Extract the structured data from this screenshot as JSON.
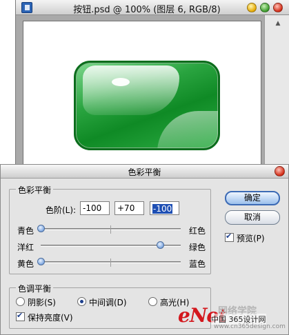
{
  "document": {
    "title": "按钮.psd @ 100% (图层 6, RGB/8)"
  },
  "dialog": {
    "title": "色彩平衡",
    "color_balance_group": "色彩平衡",
    "levels_label": "色阶(L):",
    "levels": [
      "-100",
      "+70",
      "-100"
    ],
    "sliders": [
      {
        "left": "青色",
        "right": "红色",
        "value": -100
      },
      {
        "left": "洋红",
        "right": "绿色",
        "value": 70
      },
      {
        "left": "黄色",
        "right": "蓝色",
        "value": -100
      }
    ],
    "tone_group": "色调平衡",
    "tones": [
      {
        "label": "阴影(S)",
        "checked": false
      },
      {
        "label": "中间调(D)",
        "checked": true
      },
      {
        "label": "高光(H)",
        "checked": false
      }
    ],
    "preserve_luminosity": {
      "label": "保持亮度(V)",
      "checked": true
    },
    "ok_label": "确定",
    "cancel_label": "取消",
    "preview": {
      "label": "预览(P)",
      "checked": true
    }
  },
  "watermark": {
    "logo": "eNet",
    "cn": "网络学院",
    "line1": "中国 365设计网",
    "line2": "www.cn365design.com"
  },
  "colors": {
    "accent": "#3b6ab5",
    "button_green": "#1a9a34",
    "watermark_red": "#d3171d"
  }
}
